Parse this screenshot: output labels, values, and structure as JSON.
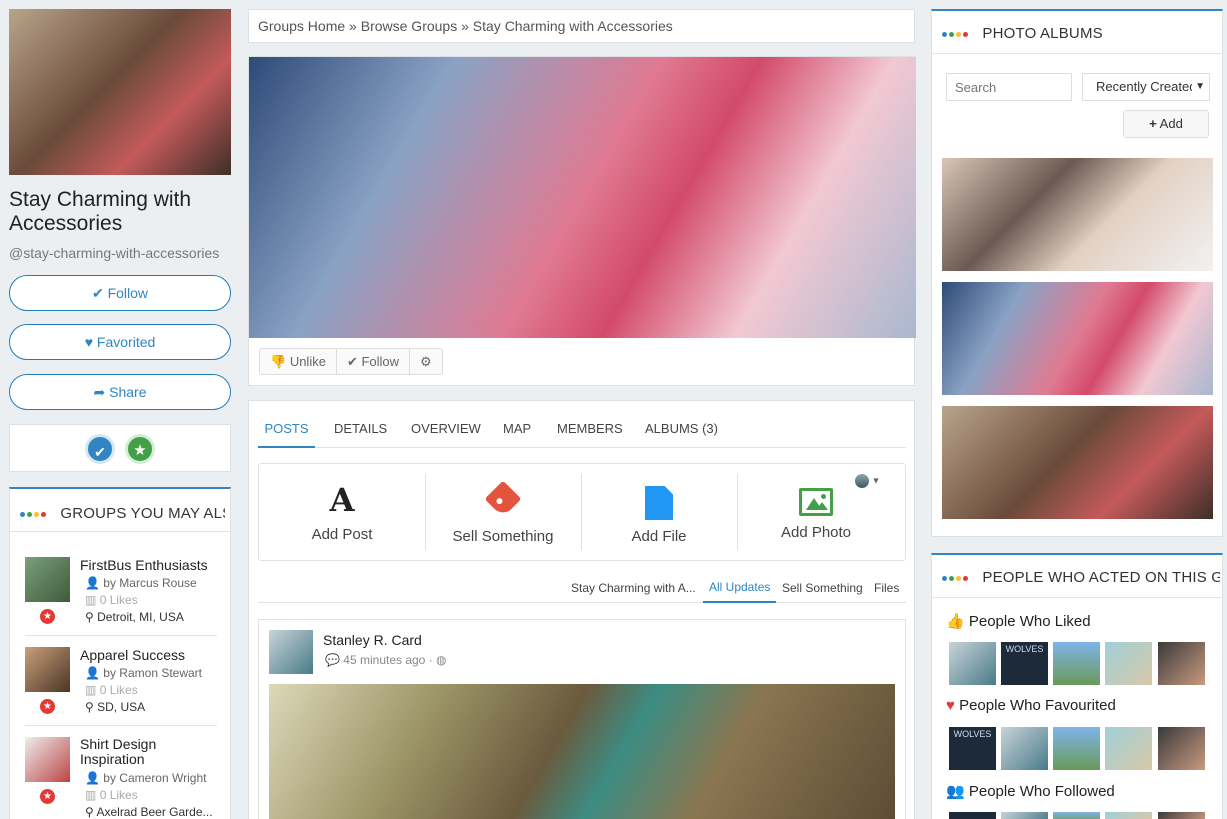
{
  "group": {
    "name": "Stay Charming with Accessories",
    "handle": "@stay-charming-with-accessories",
    "follow_label": "Follow",
    "favorited_label": "Favorited",
    "share_label": "Share"
  },
  "suggest": {
    "header": "GROUPS YOU MAY ALS...",
    "items": [
      {
        "title": "FirstBus Enthusiasts",
        "by": "by Marcus Rouse",
        "likes": "0 Likes",
        "location": "Detroit, MI, USA"
      },
      {
        "title": "Apparel Success",
        "by": "by Ramon Stewart",
        "likes": "0 Likes",
        "location": "SD, USA"
      },
      {
        "title": "Shirt Design Inspiration",
        "by": "by Cameron Wright",
        "likes": "0 Likes",
        "location": "Axelrad Beer Garde..."
      }
    ]
  },
  "breadcrumb": {
    "home": "Groups Home",
    "sep": "»",
    "browse": "Browse Groups",
    "current": "Stay Charming with Accessories"
  },
  "cover_actions": {
    "unlike": "Unlike",
    "follow": "Follow"
  },
  "tabs": [
    "POSTS",
    "DETAILS",
    "OVERVIEW",
    "MAP",
    "MEMBERS",
    "ALBUMS (3)"
  ],
  "composer": {
    "post": "Add Post",
    "sell": "Sell Something",
    "file": "Add File",
    "photo": "Add Photo",
    "post_glyph": "A"
  },
  "filters": [
    "Stay Charming with A...",
    "All Updates",
    "Sell Something",
    "Files"
  ],
  "feed": {
    "author": "Stanley R. Card",
    "time": "45 minutes ago"
  },
  "albums": {
    "header": "PHOTO ALBUMS",
    "search_placeholder": "Search",
    "sort": "Recently Created",
    "add": "Add"
  },
  "people": {
    "header": "PEOPLE WHO ACTED ON THIS GR...",
    "liked": "People Who Liked",
    "favourited": "People Who Favourited",
    "followed": "People Who Followed",
    "wolves_text": "WOLVES"
  },
  "colors": {
    "accent": "#2f86c3",
    "red": "#e53935",
    "green": "#43a047"
  }
}
